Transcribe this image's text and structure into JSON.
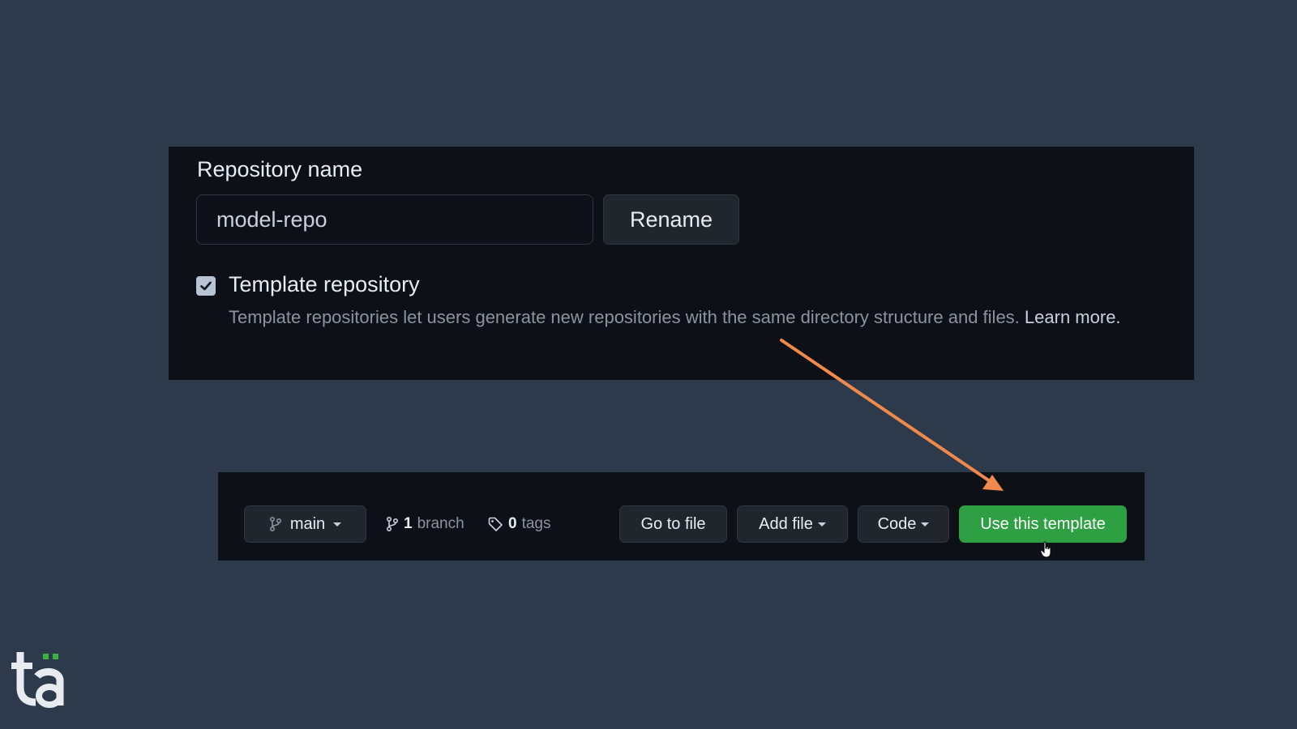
{
  "settings": {
    "repo_name_label": "Repository name",
    "repo_name_value": "model-repo",
    "rename_label": "Rename",
    "template_checkbox_label": "Template repository",
    "template_checked": true,
    "template_description": "Template repositories let users generate new repositories with the same directory structure and files.",
    "learn_more_label": "Learn more."
  },
  "toolbar": {
    "branch_name": "main",
    "branch_count": "1",
    "branch_label": "branch",
    "tag_count": "0",
    "tag_label": "tags",
    "go_to_file_label": "Go to file",
    "add_file_label": "Add file",
    "code_label": "Code",
    "use_template_label": "Use this template"
  },
  "colors": {
    "background": "#2d3a4b",
    "panel": "#0d1117",
    "button": "#21262d",
    "primary_button": "#2ea043",
    "annotation_arrow": "#f0894a",
    "logo_accent": "#3cb043"
  },
  "icons": {
    "branch_icon": "git-branch-icon",
    "tag_icon": "tag-icon",
    "checkbox": "check-icon",
    "cursor": "hand-pointer-icon"
  }
}
